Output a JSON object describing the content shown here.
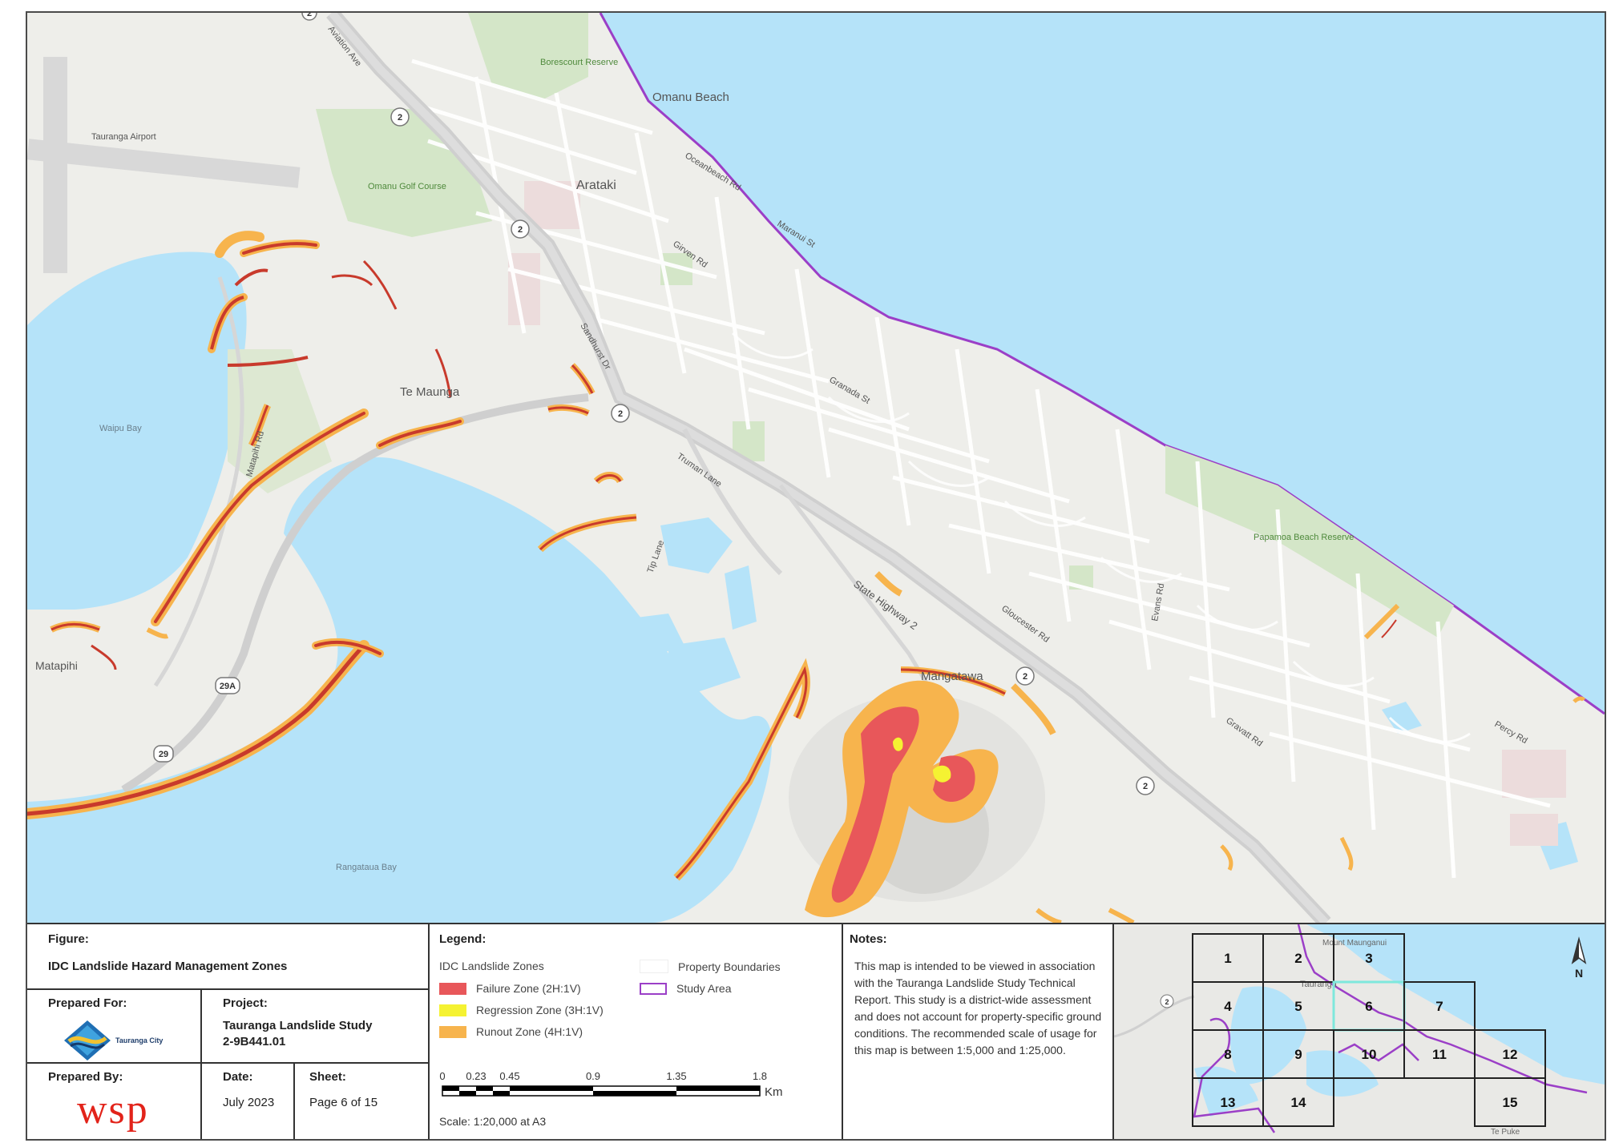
{
  "map": {
    "place_labels": {
      "omanu_beach": "Omanu Beach",
      "arataki": "Arataki",
      "te_maunga": "Te Maunga",
      "mangatawa": "Mangatawa",
      "matapihi": "Matapihi",
      "tauranga_airport": "Tauranga Airport",
      "omanu_golf_course": "Omanu Golf Course",
      "borescourt_reserve": "Borescourt Reserve",
      "papamoa_beach_reserve": "Papamoa Beach Reserve",
      "waipu_bay": "Waipu Bay",
      "rangataua_bay": "Rangataua Bay"
    },
    "road_labels": {
      "oceanbeach_rd": "Oceanbeach Rd",
      "maranui_st": "Maranui St",
      "girven_rd": "Girven Rd",
      "granada_st": "Granada St",
      "truman_lane": "Truman Lane",
      "state_highway_2": "State Highway 2",
      "gloucester_rd": "Gloucester Rd",
      "gravatt_rd": "Gravatt Rd",
      "percy_rd": "Percy Rd",
      "evans_rd": "Evans Rd",
      "tip_lane": "Tip Lane",
      "sandhurst_dr": "Sandhurst Dr",
      "matapihi_rd": "Matapihi Rd",
      "aviation_ave": "Aviation Ave"
    },
    "shields": [
      "2",
      "2",
      "2",
      "2",
      "2",
      "2",
      "29A",
      "29"
    ]
  },
  "figure": {
    "header": "Figure:",
    "title": "IDC Landslide Hazard Management Zones"
  },
  "prepared_for": {
    "header": "Prepared For:",
    "logo_text": "Tauranga City"
  },
  "project": {
    "header": "Project:",
    "name": "Tauranga Landslide Study",
    "number": "2-9B441.01"
  },
  "prepared_by": {
    "header": "Prepared By:",
    "logo_text": "wsp"
  },
  "date": {
    "header": "Date:",
    "value": "July 2023"
  },
  "sheet": {
    "header": "Sheet:",
    "value": "Page 6 of 15"
  },
  "legend": {
    "title": "Legend:",
    "group": "IDC Landslide Zones",
    "items": [
      {
        "label": "Failure Zone (2H:1V)",
        "color": "#e8575a"
      },
      {
        "label": "Regression Zone (3H:1V)",
        "color": "#f5f232"
      },
      {
        "label": "Runout Zone (4H:1V)",
        "color": "#f7b44d"
      }
    ],
    "property_boundaries": "Property Boundaries",
    "study_area": "Study Area",
    "study_area_color": "#9b3fc7",
    "scale_ticks": [
      "0",
      "0.23",
      "0.45",
      "0.9",
      "1.35",
      "1.8"
    ],
    "scale_unit": "Km",
    "scale_text": "Scale: 1:20,000 at A3"
  },
  "notes": {
    "title": "Notes:",
    "text": "This map is intended to be viewed in association with the Tauranga Landslide Study Technical Report. This study is a district-wide assessment and does not account for property-specific ground conditions. The recommended scale of usage for this map is between 1:5,000 and 1:25,000."
  },
  "inset": {
    "north": "N",
    "labels": {
      "tauranga": "Tauranga",
      "mount": "Mount Maunganui",
      "te_puke": "Te Puke"
    },
    "grid": [
      "1",
      "2",
      "3",
      "4",
      "5",
      "6",
      "7",
      "8",
      "9",
      "10",
      "11",
      "12",
      "13",
      "14",
      "15"
    ],
    "current": "6",
    "highlight_color": "#7ee8dc"
  }
}
